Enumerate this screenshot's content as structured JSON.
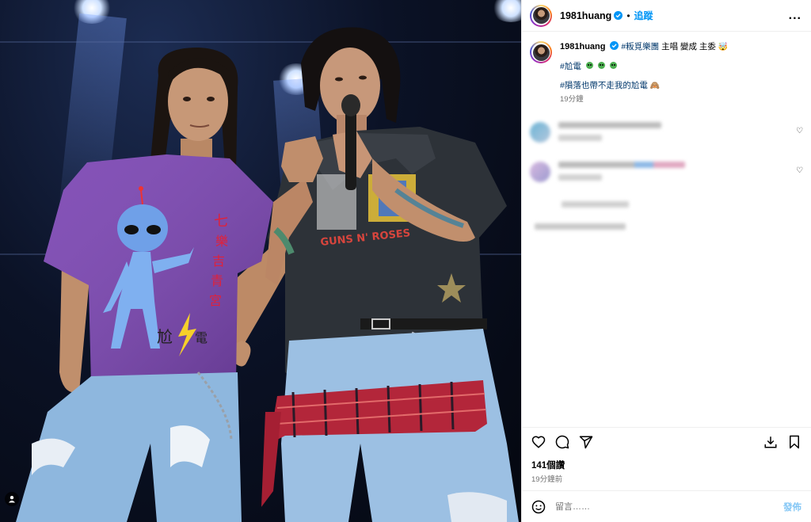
{
  "header": {
    "username": "1981huang",
    "separator": "•",
    "follow_label": "追蹤",
    "more_label": "..."
  },
  "caption": {
    "username": "1981huang",
    "line1_tag": "#粄覓樂團",
    "line1_text": "主唱 變成 主委",
    "line2_tag": "#尬電",
    "line3_tag": "#隕落也帶不走我的尬電",
    "time": "19分鐘"
  },
  "likes": "141個讚",
  "post_time": "19分鐘前",
  "comment_input": {
    "placeholder": "留言……"
  },
  "post_button": "發佈",
  "photo": {
    "left_shirt_text": "七樂吉青宮",
    "left_shirt_bottom": "尬電",
    "right_shirt_text": "GUNS N' ROSES"
  },
  "colors": {
    "link_blue": "#0095f6",
    "post_disabled": "#85c7f5",
    "hashtag": "#00376b"
  }
}
